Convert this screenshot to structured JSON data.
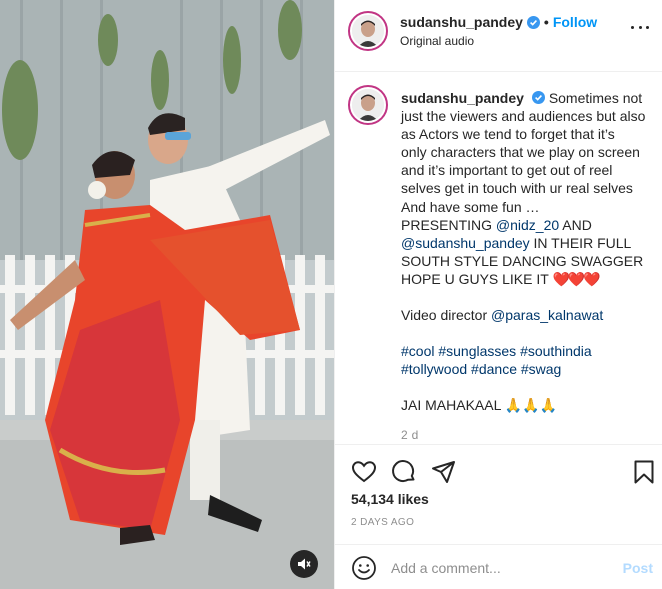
{
  "post": {
    "username": "sudanshu_pandey",
    "follow_label": "Follow",
    "separator": "•",
    "audio": "Original audio"
  },
  "caption": {
    "username": "sudanshu_pandey",
    "line1": "Sometimes not",
    "line2": "just the viewers and audiences but also",
    "line3": "as Actors we tend to forget that it’s",
    "line4": "only characters that we play on screen",
    "line5": "and it’s important to get out of reel",
    "line6": "selves get in touch with ur real selves",
    "line7": "And have some fun …",
    "line8_pre": "PRESENTING ",
    "mention1": "@nidz_20",
    "line8_post": " AND",
    "mention2": "@sudanshu_pandey",
    "line9_post": " IN THEIR FULL",
    "line10": "SOUTH STYLE DANCING SWAGGER",
    "line11": "HOPE U GUYS LIKE IT ",
    "hearts": "❤️❤️❤️",
    "director_pre": "Video director ",
    "mention3": "@paras_kalnawat",
    "tags1": [
      "#cool",
      "#sunglasses",
      "#southindia"
    ],
    "tags2": [
      "#tollywood",
      "#dance",
      "#swag"
    ],
    "closing": "JAI MAHAKAAL ",
    "closing_emoji": "🙏🙏🙏",
    "time_ago": "2 d"
  },
  "engagement": {
    "likes": "54,134 likes",
    "date": "2 DAYS AGO"
  },
  "comment": {
    "placeholder": "Add a comment...",
    "post_label": "Post"
  },
  "icons": {
    "verified": "verified-badge-icon",
    "like": "heart-icon",
    "comment": "comment-icon",
    "share": "share-icon",
    "save": "bookmark-icon",
    "emoji": "emoji-icon",
    "more": "more-options-icon",
    "mute": "mute-icon"
  },
  "colors": {
    "accent": "#0095f6",
    "verified": "#3897f0",
    "post_disabled": "#b3dbff",
    "hashtag": "#00376b"
  }
}
